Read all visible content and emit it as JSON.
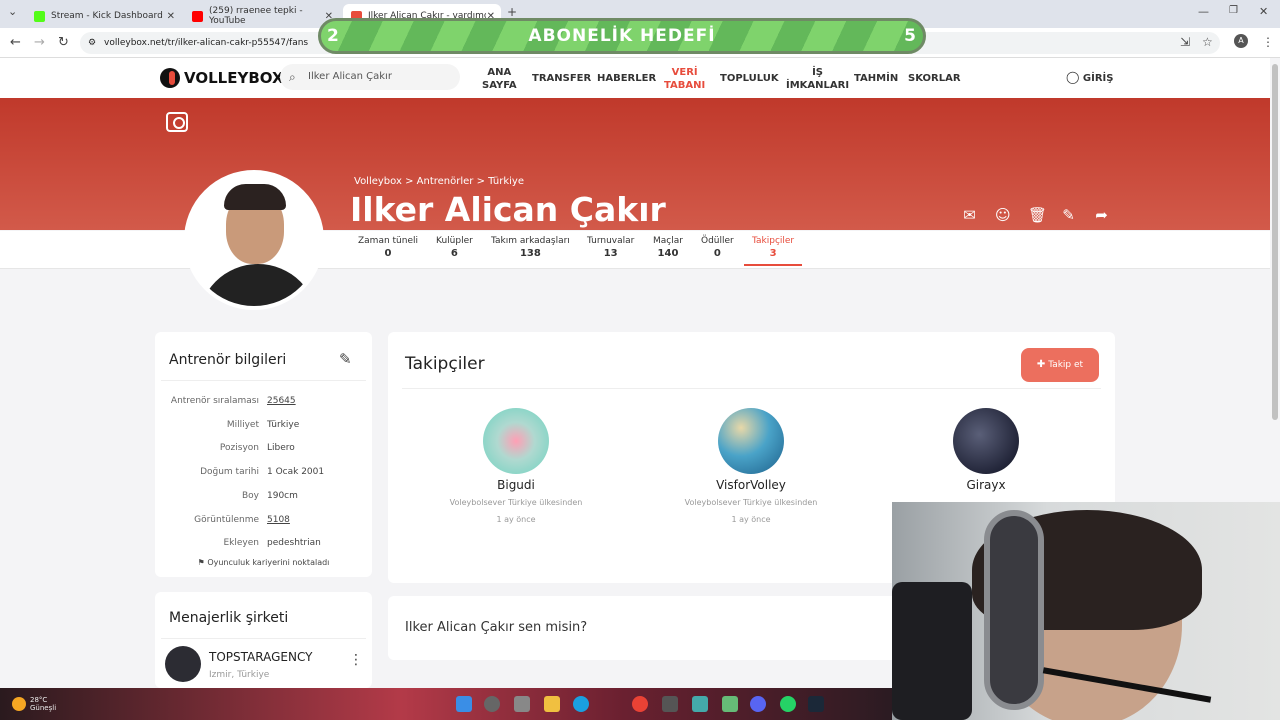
{
  "browser": {
    "tabs": [
      {
        "title": "Stream - Kick Dashboard",
        "favicon_color": "#53fc18"
      },
      {
        "title": "(259) rraenee tepki - YouTube",
        "favicon_color": "#ff0000"
      },
      {
        "title": "Ilker Alican Çakır - vardımcı volc",
        "favicon_color": "#e74c3c"
      }
    ],
    "url": "volleybox.net/tr/ilker-alican-cakr-p55547/fans",
    "profile_initial": "A"
  },
  "overlay": {
    "goal_label": "ABONELİK HEDEFİ",
    "current": "2",
    "target": "5"
  },
  "site": {
    "logo": "VOLLEYBOX",
    "search_value": "Ilker Alican Çakır",
    "nav": [
      {
        "label_1": "ANA",
        "label_2": "SAYFA"
      },
      {
        "label_1": "TRANSFER",
        "label_2": ""
      },
      {
        "label_1": "HABERLER",
        "label_2": ""
      },
      {
        "label_1": "VERİ",
        "label_2": "TABANI"
      },
      {
        "label_1": "TOPLULUK",
        "label_2": ""
      },
      {
        "label_1": "İŞ",
        "label_2": "İMKANLARI"
      },
      {
        "label_1": "TAHMİN",
        "label_2": ""
      },
      {
        "label_1": "SKORLAR",
        "label_2": ""
      }
    ],
    "login": "GİRİŞ"
  },
  "profile": {
    "breadcrumb": [
      "Volleybox",
      "Antrenörler",
      "Türkiye"
    ],
    "name": "Ilker Alican Çakır",
    "tabs": [
      {
        "label": "Zaman tüneli",
        "count": "0"
      },
      {
        "label": "Kulüpler",
        "count": "6"
      },
      {
        "label": "Takım arkadaşları",
        "count": "138"
      },
      {
        "label": "Turnuvalar",
        "count": "13"
      },
      {
        "label": "Maçlar",
        "count": "140"
      },
      {
        "label": "Ödüller",
        "count": "0"
      },
      {
        "label": "Takipçiler",
        "count": "3"
      }
    ]
  },
  "info": {
    "title": "Antrenör bilgileri",
    "rows": [
      {
        "k": "Antrenör sıralaması",
        "v": "25645"
      },
      {
        "k": "Milliyet",
        "v": "Türkiye"
      },
      {
        "k": "Pozisyon",
        "v": "Libero"
      },
      {
        "k": "Doğum tarihi",
        "v": "1 Ocak 2001"
      },
      {
        "k": "Boy",
        "v": "190cm"
      },
      {
        "k": "Görüntülenme",
        "v": "5108"
      },
      {
        "k": "Ekleyen",
        "v": "pedeshtrian"
      }
    ],
    "career_link": "Oyunculuk kariyerini noktaladı"
  },
  "agency": {
    "title": "Menajerlik şirketi",
    "name": "TOPSTARAGENCY",
    "location": "Izmir, Türkiye"
  },
  "fans": {
    "title": "Takipçiler",
    "follow_label": "Takip et",
    "items": [
      {
        "name": "Bigudi",
        "sub": "Voleybolsever Türkiye ülkesinden",
        "time": "1 ay önce"
      },
      {
        "name": "VisforVolley",
        "sub": "Voleybolsever Türkiye ülkesinden",
        "time": "1 ay önce"
      },
      {
        "name": "Girayx",
        "sub": "",
        "time": ""
      }
    ]
  },
  "claim": {
    "text": "Ilker Alican Çakır sen misin?"
  },
  "taskbar": {
    "weather_temp": "28°C",
    "weather_desc": "Güneşli"
  }
}
